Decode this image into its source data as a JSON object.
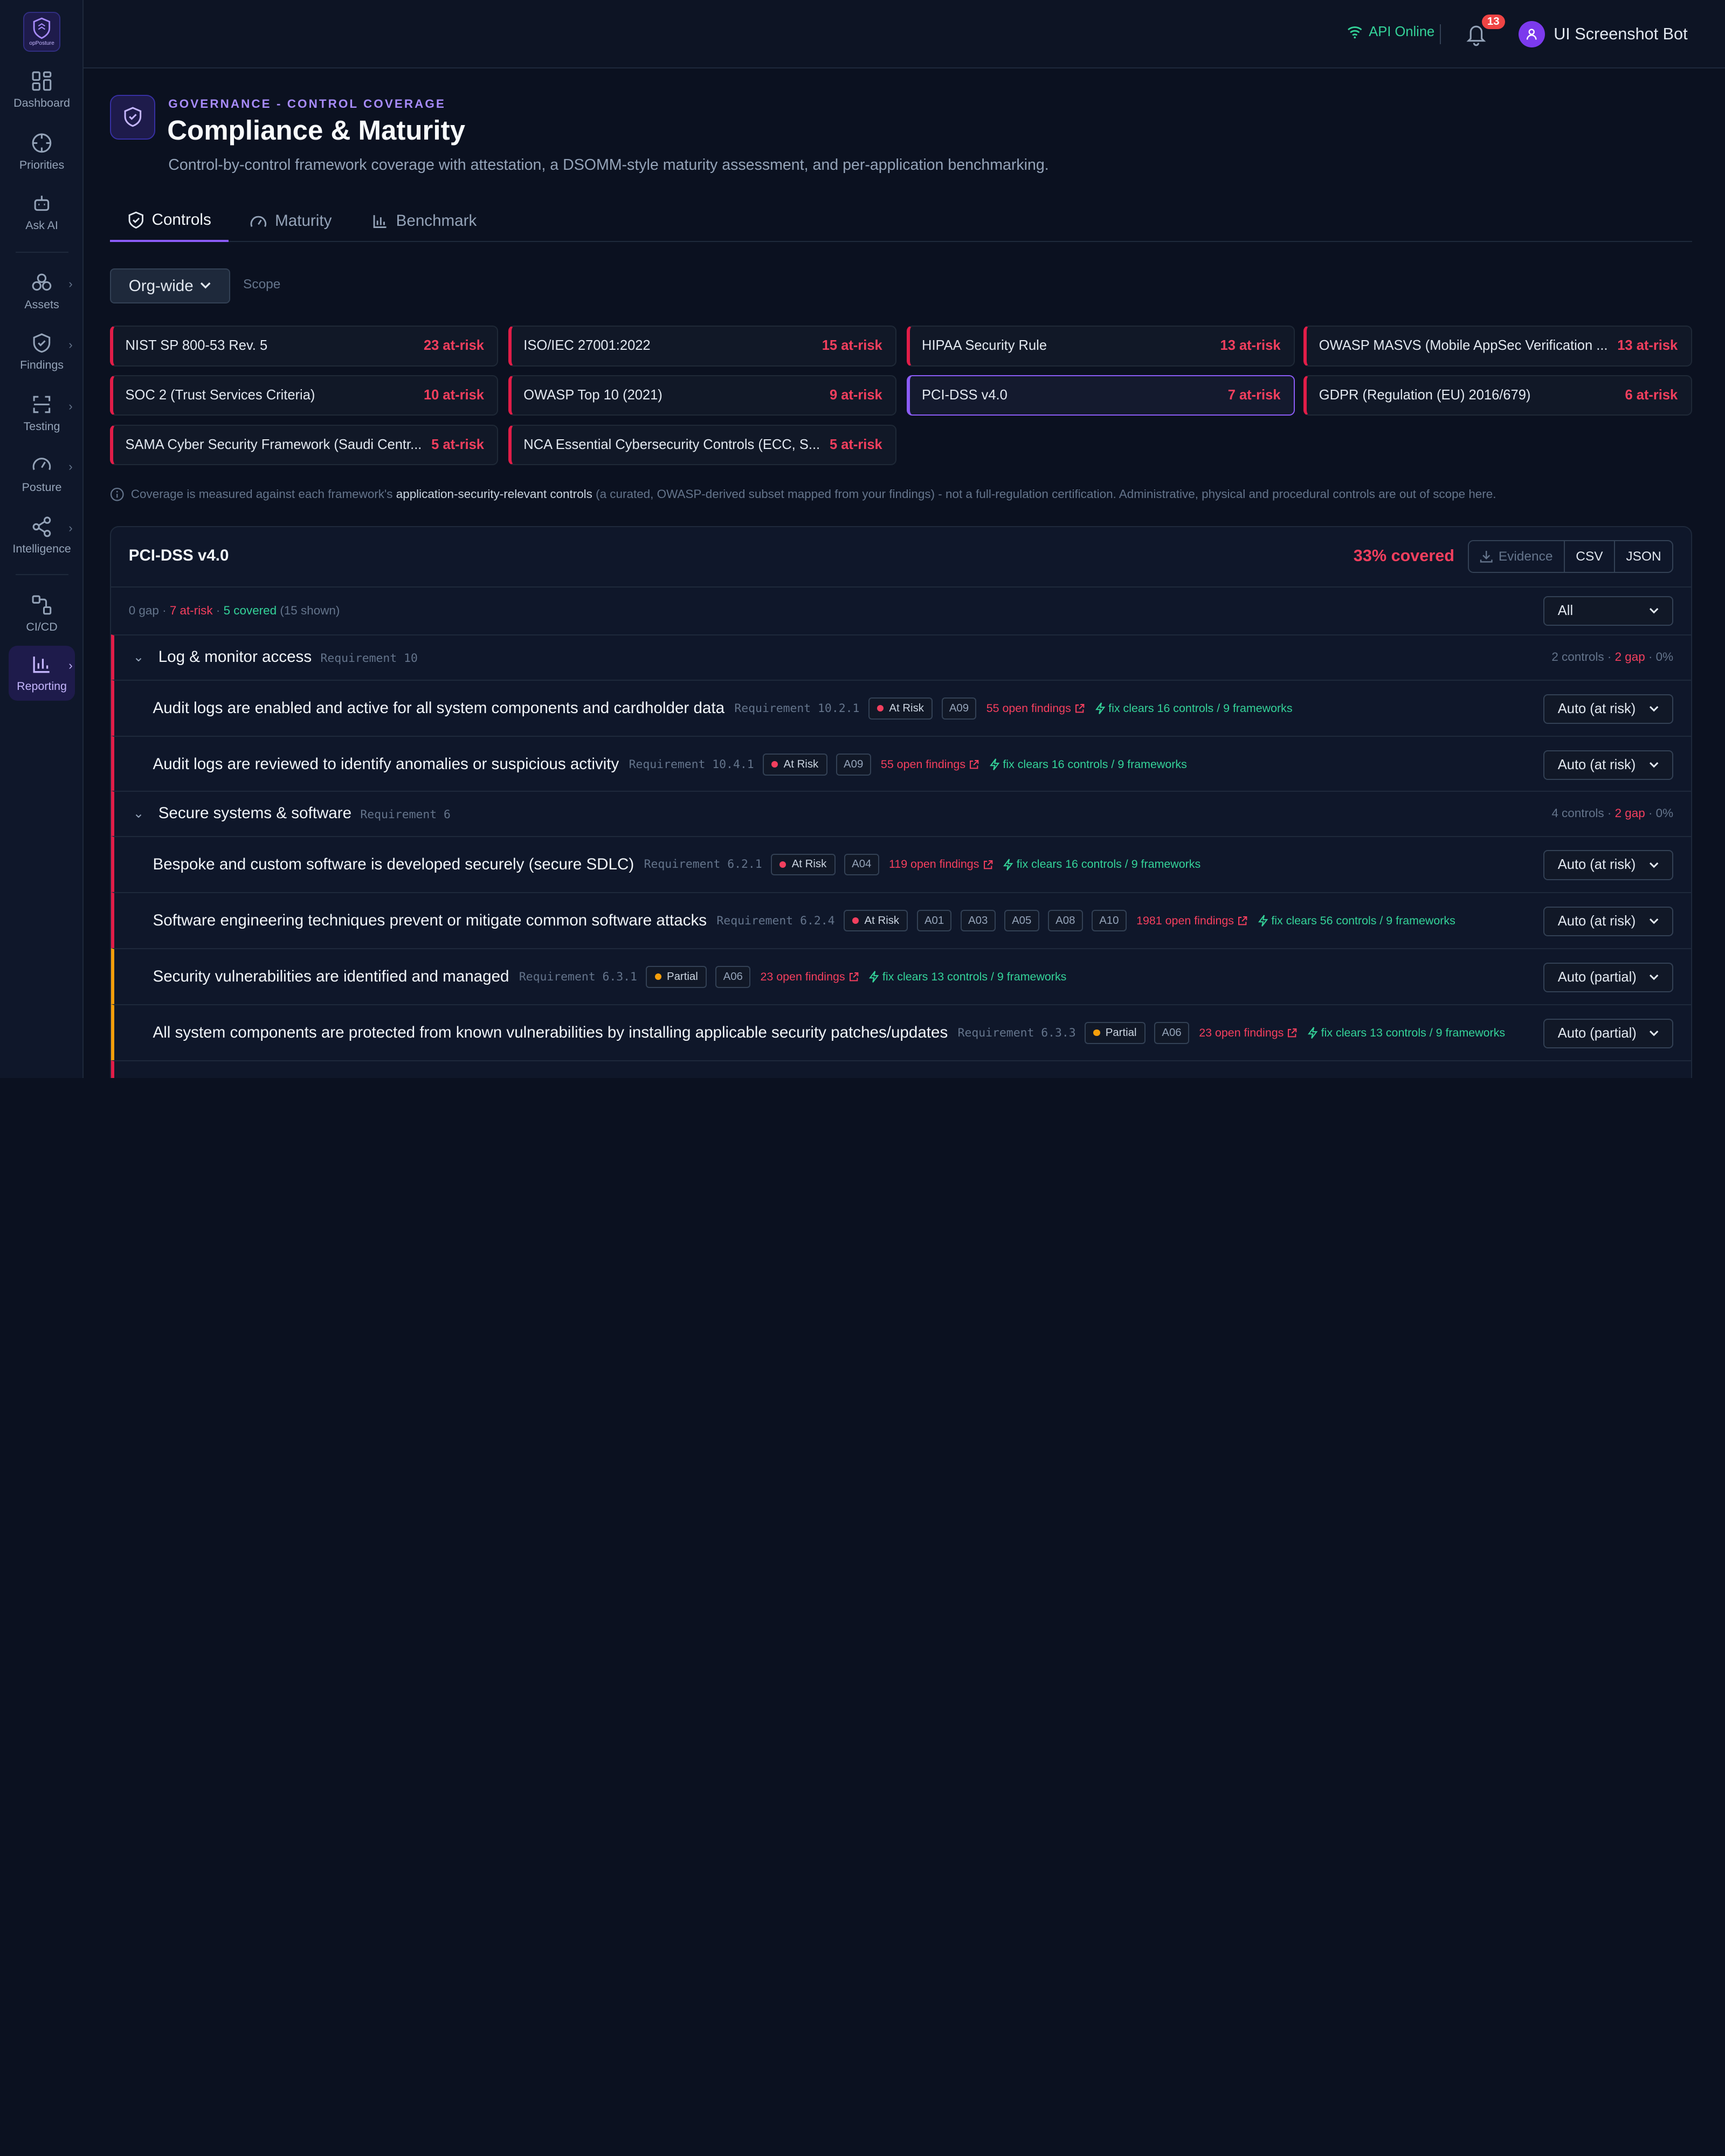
{
  "app": {
    "logo_text": "opPosture"
  },
  "sidebar": {
    "items": [
      {
        "label": "Dashboard",
        "icon": "dashboard-icon"
      },
      {
        "label": "Priorities",
        "icon": "crosshair-icon"
      },
      {
        "label": "Ask AI",
        "icon": "robot-icon"
      },
      {
        "label": "Assets",
        "icon": "assets-icon"
      },
      {
        "label": "Findings",
        "icon": "shield-icon"
      },
      {
        "label": "Testing",
        "icon": "scan-icon"
      },
      {
        "label": "Posture",
        "icon": "gauge-icon"
      },
      {
        "label": "Intelligence",
        "icon": "share-icon"
      },
      {
        "label": "CI/CD",
        "icon": "pipeline-icon"
      },
      {
        "label": "Reporting",
        "icon": "bar-chart-icon"
      }
    ]
  },
  "topbar": {
    "api_status": "API Online",
    "notification_count": "13",
    "user_name": "UI Screenshot Bot"
  },
  "header": {
    "eyebrow": "GOVERNANCE - CONTROL COVERAGE",
    "title": "Compliance & Maturity",
    "subtitle": "Control-by-control framework coverage with attestation, a DSOMM-style maturity assessment, and per-application benchmarking."
  },
  "tabs": [
    {
      "label": "Controls"
    },
    {
      "label": "Maturity"
    },
    {
      "label": "Benchmark"
    }
  ],
  "scope": {
    "value": "Org-wide",
    "label": "Scope"
  },
  "frameworks": [
    {
      "name": "NIST SP 800-53 Rev. 5",
      "risk": "23 at-risk"
    },
    {
      "name": "ISO/IEC 27001:2022",
      "risk": "15 at-risk"
    },
    {
      "name": "HIPAA Security Rule",
      "risk": "13 at-risk"
    },
    {
      "name": "OWASP MASVS (Mobile AppSec Verification ...",
      "risk": "13 at-risk"
    },
    {
      "name": "SOC 2 (Trust Services Criteria)",
      "risk": "10 at-risk"
    },
    {
      "name": "OWASP Top 10 (2021)",
      "risk": "9 at-risk"
    },
    {
      "name": "PCI-DSS v4.0",
      "risk": "7 at-risk"
    },
    {
      "name": "GDPR (Regulation (EU) 2016/679)",
      "risk": "6 at-risk"
    },
    {
      "name": "SAMA Cyber Security Framework (Saudi Centr...",
      "risk": "5 at-risk"
    },
    {
      "name": "NCA Essential Cybersecurity Controls (ECC, S...",
      "risk": "5 at-risk"
    }
  ],
  "note": {
    "pre": "Coverage is measured against each framework's",
    "bold": "application-security-relevant controls",
    "post": "(a curated, OWASP-derived subset mapped from your findings) - not a full-regulation certification. Administrative, physical and procedural controls are out of scope here."
  },
  "panel": {
    "title": "PCI-DSS v4.0",
    "covered": "33% covered",
    "buttons": {
      "evidence": "Evidence",
      "csv": "CSV",
      "json": "JSON"
    },
    "summary": {
      "gap": "0 gap",
      "at_risk": "7 at-risk",
      "covered": "5 covered",
      "shown": "(15 shown)"
    },
    "filter": "All",
    "groups": [
      {
        "title": "Log & monitor access",
        "req": "Requirement 10",
        "meta_pre": "2 controls ·",
        "meta_gap": "2 gap",
        "meta_post": "· 0%"
      },
      {
        "title": "Secure systems & software",
        "req": "Requirement 6",
        "meta_pre": "4 controls ·",
        "meta_gap": "2 gap",
        "meta_post": "· 0%"
      }
    ],
    "controls": [
      {
        "title": "Audit logs are enabled and active for all system components and cardholder data",
        "req": "Requirement 10.2.1",
        "status": "At Risk",
        "tags": [
          "A09"
        ],
        "findings": "55 open findings",
        "fix": "fix clears 16 controls / 9 frameworks",
        "select": "Auto (at risk)"
      },
      {
        "title": "Audit logs are reviewed to identify anomalies or suspicious activity",
        "req": "Requirement 10.4.1",
        "status": "At Risk",
        "tags": [
          "A09"
        ],
        "findings": "55 open findings",
        "fix": "fix clears 16 controls / 9 frameworks",
        "select": "Auto (at risk)"
      },
      {
        "title": "Bespoke and custom software is developed securely (secure SDLC)",
        "req": "Requirement 6.2.1",
        "status": "At Risk",
        "tags": [
          "A04"
        ],
        "findings": "119 open findings",
        "fix": "fix clears 16 controls / 9 frameworks",
        "select": "Auto (at risk)"
      },
      {
        "title": "Software engineering techniques prevent or mitigate common software attacks",
        "req": "Requirement 6.2.4",
        "status": "At Risk",
        "tags": [
          "A01",
          "A03",
          "A05",
          "A08",
          "A10"
        ],
        "findings": "1981 open findings",
        "fix": "fix clears 56 controls / 9 frameworks",
        "select": "Auto (at risk)"
      },
      {
        "title": "Security vulnerabilities are identified and managed",
        "req": "Requirement 6.3.1",
        "status": "Partial",
        "tags": [
          "A06"
        ],
        "findings": "23 open findings",
        "fix": "fix clears 13 controls / 9 frameworks",
        "select": "Auto (partial)"
      },
      {
        "title": "All system components are protected from known vulnerabilities by installing applicable security patches/updates",
        "req": "Requirement 6.3.3",
        "status": "Partial",
        "tags": [
          "A06"
        ],
        "findings": "23 open findings",
        "fix": "fix clears 13 controls / 9 frameworks",
        "select": "Auto (partial)"
      }
    ]
  },
  "colors": {
    "accent": "#8b5cf6",
    "risk": "#f43f5e",
    "ok": "#34d399",
    "partial": "#f59e0b"
  }
}
